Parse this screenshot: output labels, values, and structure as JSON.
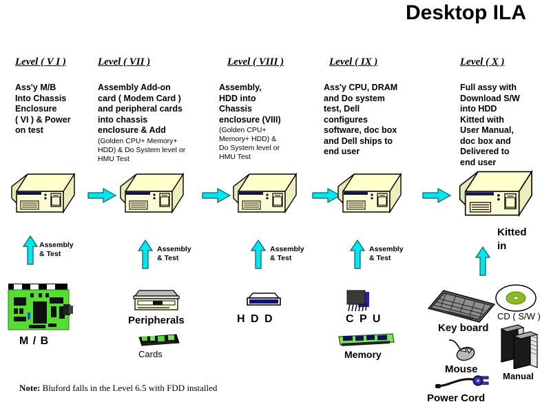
{
  "title": "Desktop ILA",
  "levels": [
    {
      "header": "Level ( V I )",
      "body": "Ass'y  M/B\nInto Chassis\nEnclosure\n( VI )  & Power\non test",
      "sub": ""
    },
    {
      "header": "Level ( VII )",
      "body": "Assembly   Add-on\ncard ( Modem Card )\nand peripheral cards\ninto chassis\nenclosure & Add",
      "sub": "(Golden CPU+  Memory+\nHDD)  & Do  System level or\nHMU  Test"
    },
    {
      "header": "Level ( VIII )",
      "body": "Assembly,\nHDD  into\nChassis\nenclosure (VIII)",
      "sub": "(Golden CPU+\nMemory+ HDD) &\nDo System level or\nHMU  Test"
    },
    {
      "header": "Level ( IX )",
      "body": "Ass'y  CPU, DRAM\nand  Do  system\ntest, Dell\nconfigures\nsoftware, doc box\nand Dell ships to\nend user",
      "sub": ""
    },
    {
      "header": "Level  ( X )",
      "body": "Full assy  with\nDownload S/W\ninto HDD\nKitted  with\nUser Manual,\ndoc box and\nDelivered to\nend user",
      "sub": ""
    }
  ],
  "flow_arrows": [
    {
      "name": "flow-arrow-1"
    },
    {
      "name": "flow-arrow-2"
    },
    {
      "name": "flow-arrow-3"
    },
    {
      "name": "flow-arrow-4"
    }
  ],
  "assembly_arrows": [
    {
      "label": "Assembly\n& Test"
    },
    {
      "label": "Assembly\n& Test"
    },
    {
      "label": "Assembly\n& Test"
    },
    {
      "label": "Assembly\n& Test"
    }
  ],
  "kitted_label": "Kitted\nin",
  "components": {
    "mb": "M / B",
    "peripherals": "Peripherals",
    "cards": "Cards",
    "hdd": "H D D",
    "cpu": "C P U",
    "memory": "Memory",
    "keyboard": "Key board",
    "cd": "CD ( S/W )",
    "mouse": "Mouse",
    "manual": "Manual",
    "power_cord": "Power  Cord"
  },
  "note": {
    "prefix": "Note:",
    "text": " Bluford falls in the Level 6.5 with FDD installed"
  },
  "colors": {
    "chassis_fill": "#ffffcc",
    "chassis_side": "#eeeeba",
    "arrow_cyan": "#00e5ee",
    "pcb_green": "#55dd33",
    "cpu_blue": "#2222aa",
    "hdd_blue": "#111177",
    "cd_green": "#88bb22",
    "outline": "#000000",
    "background": "#ffffff"
  }
}
